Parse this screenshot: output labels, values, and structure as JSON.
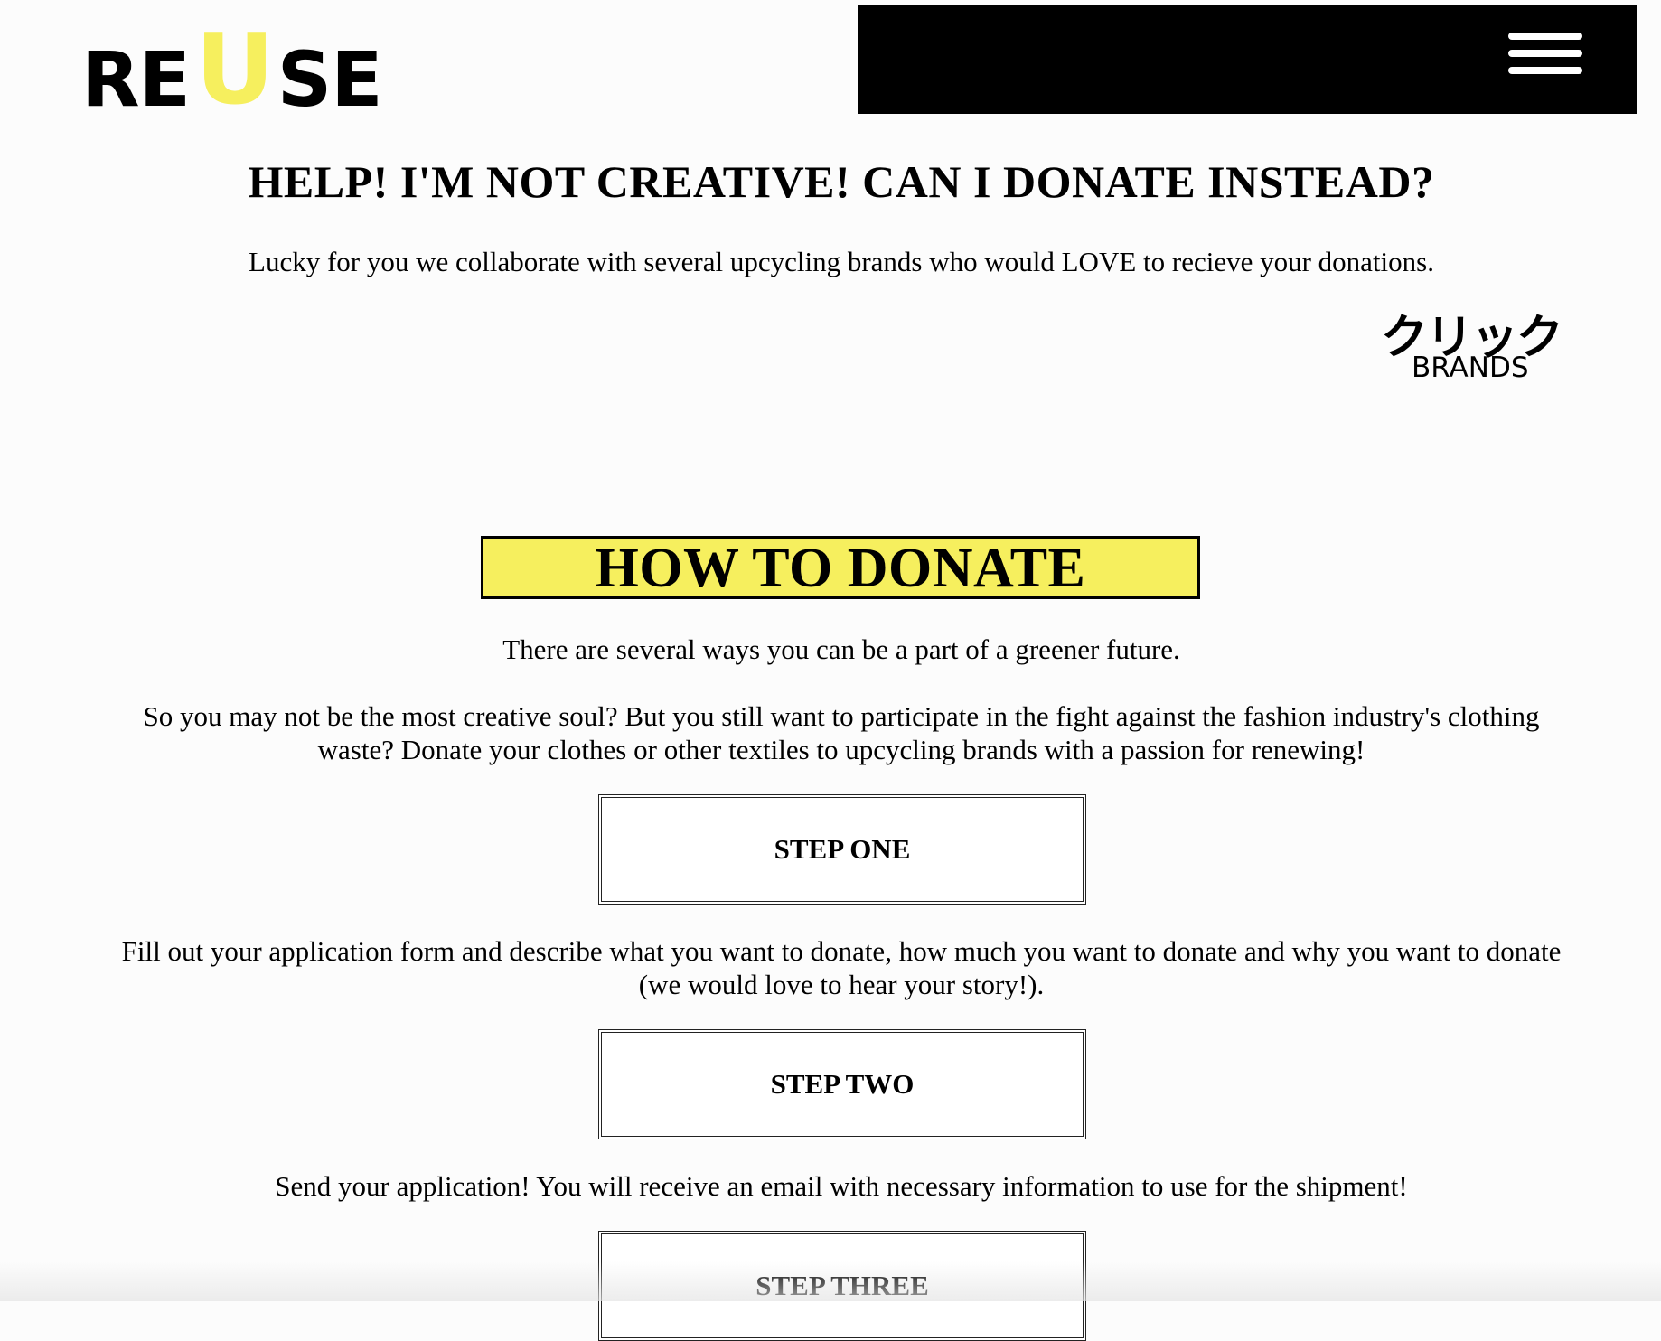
{
  "header": {
    "logo": {
      "prefix": "RE",
      "highlight": "U",
      "suffix": "SE",
      "highlight_color": "#f6ef5e"
    },
    "menu_icon": "hamburger-menu-icon"
  },
  "main": {
    "title": "HELP! I'M NOT CREATIVE! CAN I DONATE INSTEAD?",
    "intro": "Lucky for you we collaborate with several upcycling brands who would LOVE to recieve your donations.",
    "brands_link": {
      "kana": "クリック",
      "label": "BRANDS"
    },
    "how_to_donate": {
      "heading": "HOW TO DONATE",
      "heading_bg": "#f6ef5e",
      "subtitle": "There are several ways you can be a part of a greener future.",
      "description": "So you may not be the most creative soul? But you still want to participate in the fight against the fashion industry's clothing waste? Donate your clothes or other textiles to upcycling brands with a passion for renewing!",
      "steps": [
        {
          "label": "STEP ONE",
          "text": "Fill out your application form and describe what you want to donate, how much you want to donate and why you want to donate (we would love to hear your story!)."
        },
        {
          "label": "STEP TWO",
          "text": "Send your application! You will receive an email with necessary information to use for the shipment!"
        },
        {
          "label": "STEP THREE"
        }
      ]
    }
  }
}
